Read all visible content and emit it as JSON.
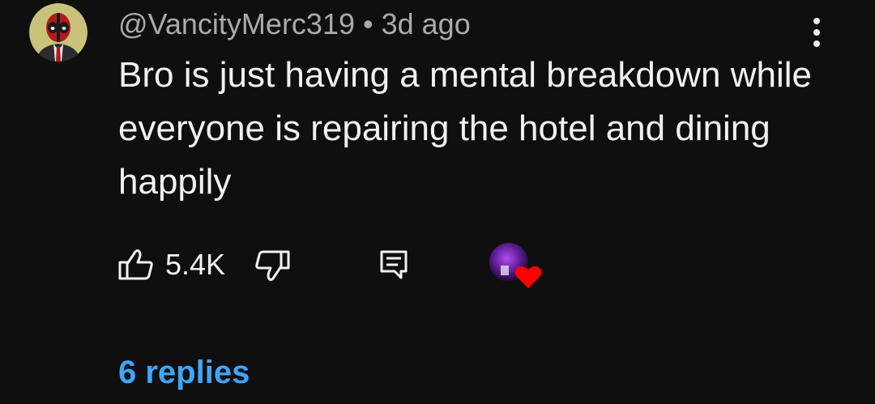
{
  "comment": {
    "author_handle": "@VancityMerc319",
    "separator": "•",
    "timestamp": "3d ago",
    "text": "Bro is just having a mental breakdown while everyone is repairing the hotel and dining happily",
    "avatar_icon": "deadpool-avatar-icon"
  },
  "actions": {
    "like_icon": "thumbs-up-icon",
    "like_count": "5.4K",
    "dislike_icon": "thumbs-down-icon",
    "reply_icon": "reply-comment-icon",
    "creator_heart_icon": "creator-heart-icon"
  },
  "menu": {
    "icon": "more-vertical-icon"
  },
  "replies": {
    "label": "6 replies"
  },
  "colors": {
    "background": "#0f0f0f",
    "text_primary": "#f1f1f1",
    "text_secondary": "#aaaaaa",
    "link": "#3ea6ff",
    "heart": "#ff0000"
  }
}
